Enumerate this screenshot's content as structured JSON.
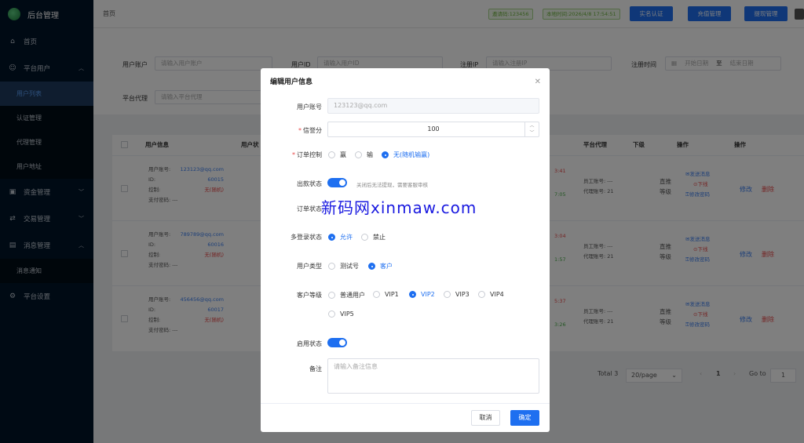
{
  "app": {
    "title": "后台管理"
  },
  "sidebar": {
    "items": [
      {
        "label": "首页",
        "icon": "home-icon"
      },
      {
        "label": "平台用户",
        "icon": "user-icon"
      },
      {
        "label": "用户列表"
      },
      {
        "label": "认证管理"
      },
      {
        "label": "代理管理"
      },
      {
        "label": "用户地址"
      },
      {
        "label": "资金管理",
        "icon": "wallet-icon"
      },
      {
        "label": "交易管理",
        "icon": "trade-icon"
      },
      {
        "label": "消息管理",
        "icon": "message-icon"
      },
      {
        "label": "消息通知"
      },
      {
        "label": "平台设置",
        "icon": "gear-icon"
      }
    ]
  },
  "topbar": {
    "breadcrumb": "首页",
    "invite_code": "邀请码:123456",
    "local_time": "本地时间:2026/4/8 17:54:51",
    "btn_verify": "实名认证",
    "btn_recharge": "充值管理",
    "btn_withdraw": "提现管理"
  },
  "filters": {
    "account_label": "用户账户",
    "account_ph": "请输入用户账户",
    "id_label": "用户ID",
    "id_ph": "请输入用户ID",
    "ip_label": "注册IP",
    "ip_ph": "请输入注册IP",
    "time_label": "注册时间",
    "start_ph": "开始日期",
    "to": "至",
    "end_ph": "结束日期",
    "agent_label": "平台代理",
    "agent_ph": "请输入平台代理"
  },
  "table": {
    "headers": {
      "user_info": "用户信息",
      "user_status": "用户状",
      "agent": "平台代理",
      "sub": "下级",
      "op1": "操作",
      "op2": "操作"
    },
    "rows": [
      {
        "account": "123123@qq.com",
        "id": "60015",
        "control": "无(随机)",
        "paypwd": "支付密码: ---",
        "time1": "3:41",
        "time2": "7:05",
        "staff": "员工账号: ---",
        "agent_acct": "代理账号: 21",
        "sub1": "直推",
        "sub2": "等级"
      },
      {
        "account": "789789@qq.com",
        "id": "60016",
        "control": "无(随机)",
        "paypwd": "支付密码: ---",
        "time1": "3:04",
        "time2": "1:57",
        "staff": "员工账号: ---",
        "agent_acct": "代理账号: 21",
        "sub1": "直推",
        "sub2": "等级"
      },
      {
        "account": "456456@qq.com",
        "id": "60017",
        "control": "无(随机)",
        "paypwd": "支付密码: ---",
        "time1": "5:37",
        "time2": "3:26",
        "staff": "员工账号: ---",
        "agent_acct": "代理账号: 21",
        "sub1": "直推",
        "sub2": "等级"
      }
    ],
    "labels": {
      "account": "用户账号:",
      "id": "ID:",
      "control": "控制:"
    },
    "actions": {
      "send": "发送消息",
      "offline": "下线",
      "pwd": "修改密码",
      "edit": "修改",
      "delete": "删除"
    }
  },
  "pager": {
    "total": "Total 3",
    "size": "20/page",
    "page": "1",
    "goto": "Go to",
    "goto_val": "1"
  },
  "dialog": {
    "title": "编辑用户信息",
    "account_label": "用户账号",
    "account_value": "123123@qq.com",
    "credit_label": "信誉分",
    "credit_value": "100",
    "order_label": "订单控制",
    "order_options": [
      "赢",
      "输",
      "无(随机输赢)"
    ],
    "withdraw_label": "出款状态",
    "withdraw_hint": "关闭后无法提现，需要客服审核",
    "orderstate_label": "订单状态",
    "multi_label": "多登录状态",
    "multi_options": [
      "允许",
      "禁止"
    ],
    "type_label": "用户类型",
    "type_options": [
      "测试号",
      "客户"
    ],
    "level_label": "客户等级",
    "level_options": [
      "普通用户",
      "VIP1",
      "VIP2",
      "VIP3",
      "VIP4",
      "VIP5"
    ],
    "enable_label": "启用状态",
    "remark_label": "备注",
    "remark_ph": "请输入备注信息",
    "cancel": "取消",
    "confirm": "确定"
  },
  "watermark": "新码网xinmaw.com",
  "colors": {
    "primary": "#1e6ff0",
    "sidebar": "#001529",
    "danger": "#e84a4a"
  }
}
